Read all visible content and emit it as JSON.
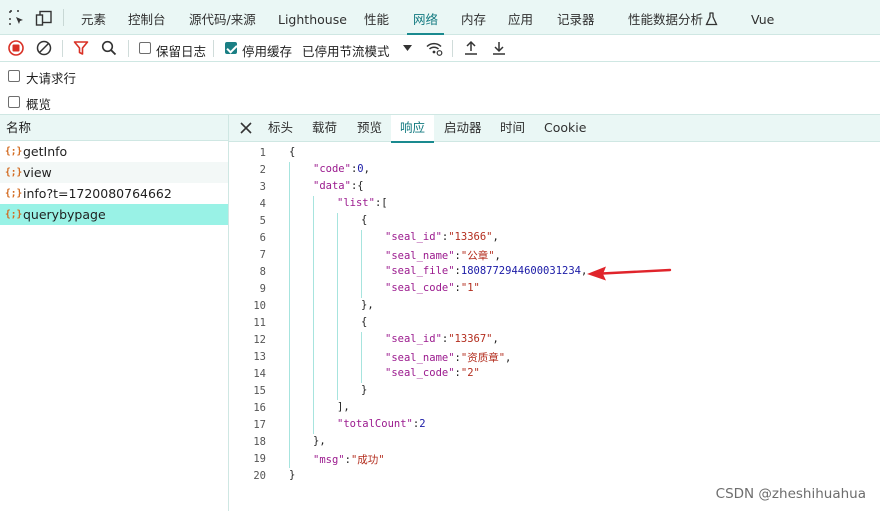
{
  "topbar": {
    "tabs": [
      {
        "label": "元素"
      },
      {
        "label": "控制台"
      },
      {
        "label": "源代码/来源"
      },
      {
        "label": "Lighthouse"
      },
      {
        "label": "性能"
      },
      {
        "label": "网络"
      },
      {
        "label": "内存"
      },
      {
        "label": "应用"
      },
      {
        "label": "记录器"
      },
      {
        "label": "性能数据分析"
      },
      {
        "label": "Vue"
      }
    ],
    "active_tab": "网络"
  },
  "toolbar": {
    "preserve_log_label": "保留日志",
    "preserve_log_checked": false,
    "disable_cache_label": "停用缓存",
    "disable_cache_checked": true,
    "throttle_value": "已停用节流模式"
  },
  "options": {
    "big_rows_label": "大请求行",
    "big_rows_checked": false,
    "overview_label": "概览",
    "overview_checked": false
  },
  "requests": {
    "header": "名称",
    "items": [
      {
        "icon": "{;}",
        "name": "getInfo"
      },
      {
        "icon": "{;}",
        "name": "view"
      },
      {
        "icon": "{;}",
        "name": "info?t=1720080764662"
      },
      {
        "icon": "{;}",
        "name": "querybypage"
      }
    ],
    "selected": "querybypage"
  },
  "detail": {
    "tabs": [
      {
        "label": "标头"
      },
      {
        "label": "载荷"
      },
      {
        "label": "预览"
      },
      {
        "label": "响应"
      },
      {
        "label": "启动器"
      },
      {
        "label": "时间"
      },
      {
        "label": "Cookie"
      }
    ],
    "active_tab": "响应"
  },
  "response_lines": [
    {
      "num": "1",
      "indent": 0,
      "tokens": [
        {
          "t": "p",
          "v": "{"
        }
      ]
    },
    {
      "num": "2",
      "indent": 1,
      "tokens": [
        {
          "t": "k",
          "v": "\"code\""
        },
        {
          "t": "p",
          "v": ":"
        },
        {
          "t": "n",
          "v": "0"
        },
        {
          "t": "p",
          "v": ","
        }
      ]
    },
    {
      "num": "3",
      "indent": 1,
      "tokens": [
        {
          "t": "k",
          "v": "\"data\""
        },
        {
          "t": "p",
          "v": ":{"
        }
      ]
    },
    {
      "num": "4",
      "indent": 2,
      "tokens": [
        {
          "t": "k",
          "v": "\"list\""
        },
        {
          "t": "p",
          "v": ":["
        }
      ]
    },
    {
      "num": "5",
      "indent": 3,
      "tokens": [
        {
          "t": "p",
          "v": "{"
        }
      ]
    },
    {
      "num": "6",
      "indent": 4,
      "tokens": [
        {
          "t": "k",
          "v": "\"seal_id\""
        },
        {
          "t": "p",
          "v": ":"
        },
        {
          "t": "s",
          "v": "\"13366\""
        },
        {
          "t": "p",
          "v": ","
        }
      ]
    },
    {
      "num": "7",
      "indent": 4,
      "tokens": [
        {
          "t": "k",
          "v": "\"seal_name\""
        },
        {
          "t": "p",
          "v": ":"
        },
        {
          "t": "s",
          "v": "\"公章\""
        },
        {
          "t": "p",
          "v": ","
        }
      ]
    },
    {
      "num": "8",
      "indent": 4,
      "tokens": [
        {
          "t": "k",
          "v": "\"seal_file\""
        },
        {
          "t": "p",
          "v": ":"
        },
        {
          "t": "n",
          "v": "1808772944600031234"
        },
        {
          "t": "p",
          "v": ","
        }
      ]
    },
    {
      "num": "9",
      "indent": 4,
      "tokens": [
        {
          "t": "k",
          "v": "\"seal_code\""
        },
        {
          "t": "p",
          "v": ":"
        },
        {
          "t": "s",
          "v": "\"1\""
        }
      ]
    },
    {
      "num": "10",
      "indent": 3,
      "tokens": [
        {
          "t": "p",
          "v": "},"
        }
      ]
    },
    {
      "num": "11",
      "indent": 3,
      "tokens": [
        {
          "t": "p",
          "v": "{"
        }
      ]
    },
    {
      "num": "12",
      "indent": 4,
      "tokens": [
        {
          "t": "k",
          "v": "\"seal_id\""
        },
        {
          "t": "p",
          "v": ":"
        },
        {
          "t": "s",
          "v": "\"13367\""
        },
        {
          "t": "p",
          "v": ","
        }
      ]
    },
    {
      "num": "13",
      "indent": 4,
      "tokens": [
        {
          "t": "k",
          "v": "\"seal_name\""
        },
        {
          "t": "p",
          "v": ":"
        },
        {
          "t": "s",
          "v": "\"资质章\""
        },
        {
          "t": "p",
          "v": ","
        }
      ]
    },
    {
      "num": "14",
      "indent": 4,
      "tokens": [
        {
          "t": "k",
          "v": "\"seal_code\""
        },
        {
          "t": "p",
          "v": ":"
        },
        {
          "t": "s",
          "v": "\"2\""
        }
      ]
    },
    {
      "num": "15",
      "indent": 3,
      "tokens": [
        {
          "t": "p",
          "v": "}"
        }
      ]
    },
    {
      "num": "16",
      "indent": 2,
      "tokens": [
        {
          "t": "p",
          "v": "],"
        }
      ]
    },
    {
      "num": "17",
      "indent": 2,
      "tokens": [
        {
          "t": "k",
          "v": "\"totalCount\""
        },
        {
          "t": "p",
          "v": ":"
        },
        {
          "t": "n",
          "v": "2"
        }
      ]
    },
    {
      "num": "18",
      "indent": 1,
      "tokens": [
        {
          "t": "p",
          "v": "},"
        }
      ]
    },
    {
      "num": "19",
      "indent": 1,
      "tokens": [
        {
          "t": "k",
          "v": "\"msg\""
        },
        {
          "t": "p",
          "v": ":"
        },
        {
          "t": "s",
          "v": "\"成功\""
        }
      ]
    },
    {
      "num": "20",
      "indent": 0,
      "tokens": [
        {
          "t": "p",
          "v": "}"
        }
      ]
    }
  ],
  "annotation": {
    "arrow_color": "#e0242b"
  },
  "watermark": "CSDN @zheshihuahua",
  "colors": {
    "accent": "#1a8a8f",
    "selected_row": "#99f2e6",
    "panel_bg": "#eaf7f5",
    "record_red": "#d93025",
    "filter_red": "#d93025",
    "json_key": "#9b1a8e",
    "json_string": "#b32d1e",
    "json_number": "#1a1aa6"
  },
  "icons": {
    "inspect": "inspect-element-icon",
    "device": "device-toggle-icon",
    "record": "record-stop-icon",
    "clear": "clear-icon",
    "filter": "filter-icon",
    "search": "search-icon",
    "throttle_dropdown": "chevron-down-icon",
    "network_conditions": "network-conditions-icon",
    "import": "import-har-icon",
    "export": "export-har-icon",
    "close_detail": "close-icon",
    "perf_insights": "flask-icon"
  }
}
